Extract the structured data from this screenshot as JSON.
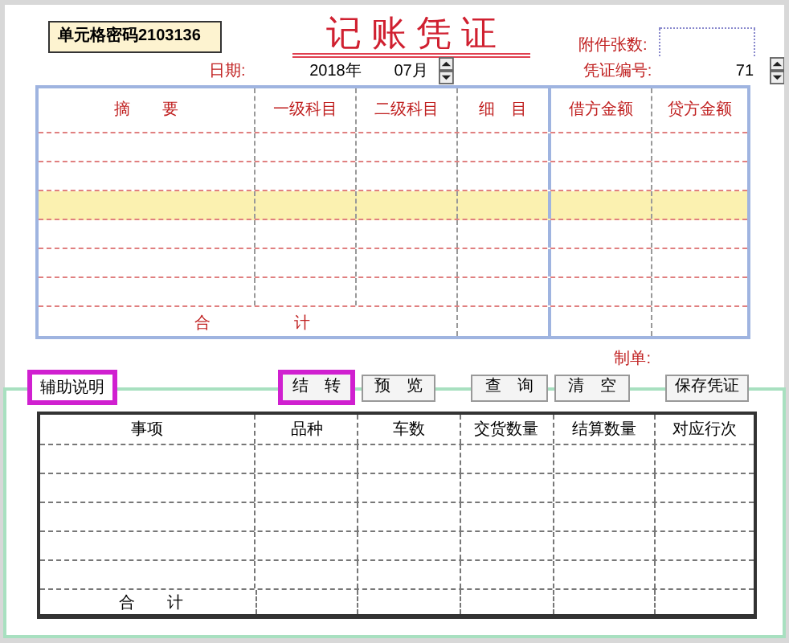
{
  "cell_password": "单元格密码2103136",
  "title": "记 账 凭 证",
  "attachments": {
    "label": "附件张数:"
  },
  "date": {
    "label": "日期:",
    "year": "2018年",
    "month": "07月"
  },
  "voucher_no": {
    "label": "凭证编号:",
    "value": "71"
  },
  "voucher_table": {
    "columns": [
      "摘　　要",
      "一级科目",
      "二级科目",
      "细　目",
      "借方金额",
      "贷方金额"
    ],
    "rows": [
      {
        "highlighted": false
      },
      {
        "highlighted": false
      },
      {
        "highlighted": true
      },
      {
        "highlighted": false
      },
      {
        "highlighted": false
      },
      {
        "highlighted": false
      }
    ],
    "total_label": [
      "合",
      "计"
    ]
  },
  "preparer": {
    "label": "制单:"
  },
  "aux_note": {
    "label": "辅助说明",
    "highlighted": true
  },
  "buttons": [
    {
      "label": "结　转",
      "highlighted": true
    },
    {
      "label": "预　览",
      "highlighted": false
    },
    {
      "label": "查　询",
      "highlighted": false
    },
    {
      "label": "清　空",
      "highlighted": false
    },
    {
      "label": "保存凭证",
      "highlighted": false
    }
  ],
  "detail_table": {
    "columns": [
      "事项",
      "品种",
      "车数",
      "交货数量",
      "结算数量",
      "对应行次"
    ],
    "total_label": [
      "合",
      "计"
    ]
  }
}
